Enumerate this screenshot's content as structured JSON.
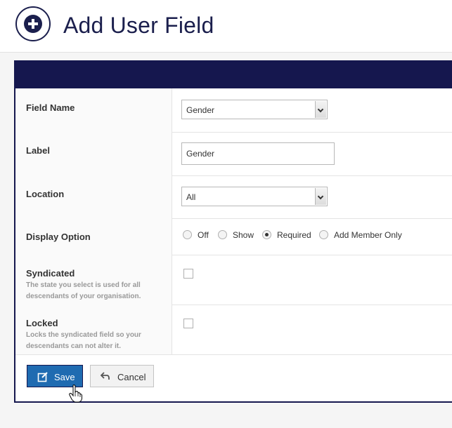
{
  "header": {
    "title": "Add User Field",
    "icon": "add-circle-icon"
  },
  "form": {
    "field_name": {
      "label": "Field Name",
      "value": "Gender"
    },
    "label_field": {
      "label": "Label",
      "value": "Gender"
    },
    "location": {
      "label": "Location",
      "value": "All"
    },
    "display_option": {
      "label": "Display Option",
      "options": [
        "Off",
        "Show",
        "Required",
        "Add Member Only"
      ],
      "selected": "Required"
    },
    "syndicated": {
      "label": "Syndicated",
      "help": "The state you select is used for all descendants of your organisation.",
      "checked": false
    },
    "locked": {
      "label": "Locked",
      "help": "Locks the syndicated field so your descendants can not alter it.",
      "checked": false
    }
  },
  "actions": {
    "save_label": "Save",
    "cancel_label": "Cancel"
  },
  "colors": {
    "brand_navy": "#15174e",
    "save_blue": "#1f6bb1"
  }
}
